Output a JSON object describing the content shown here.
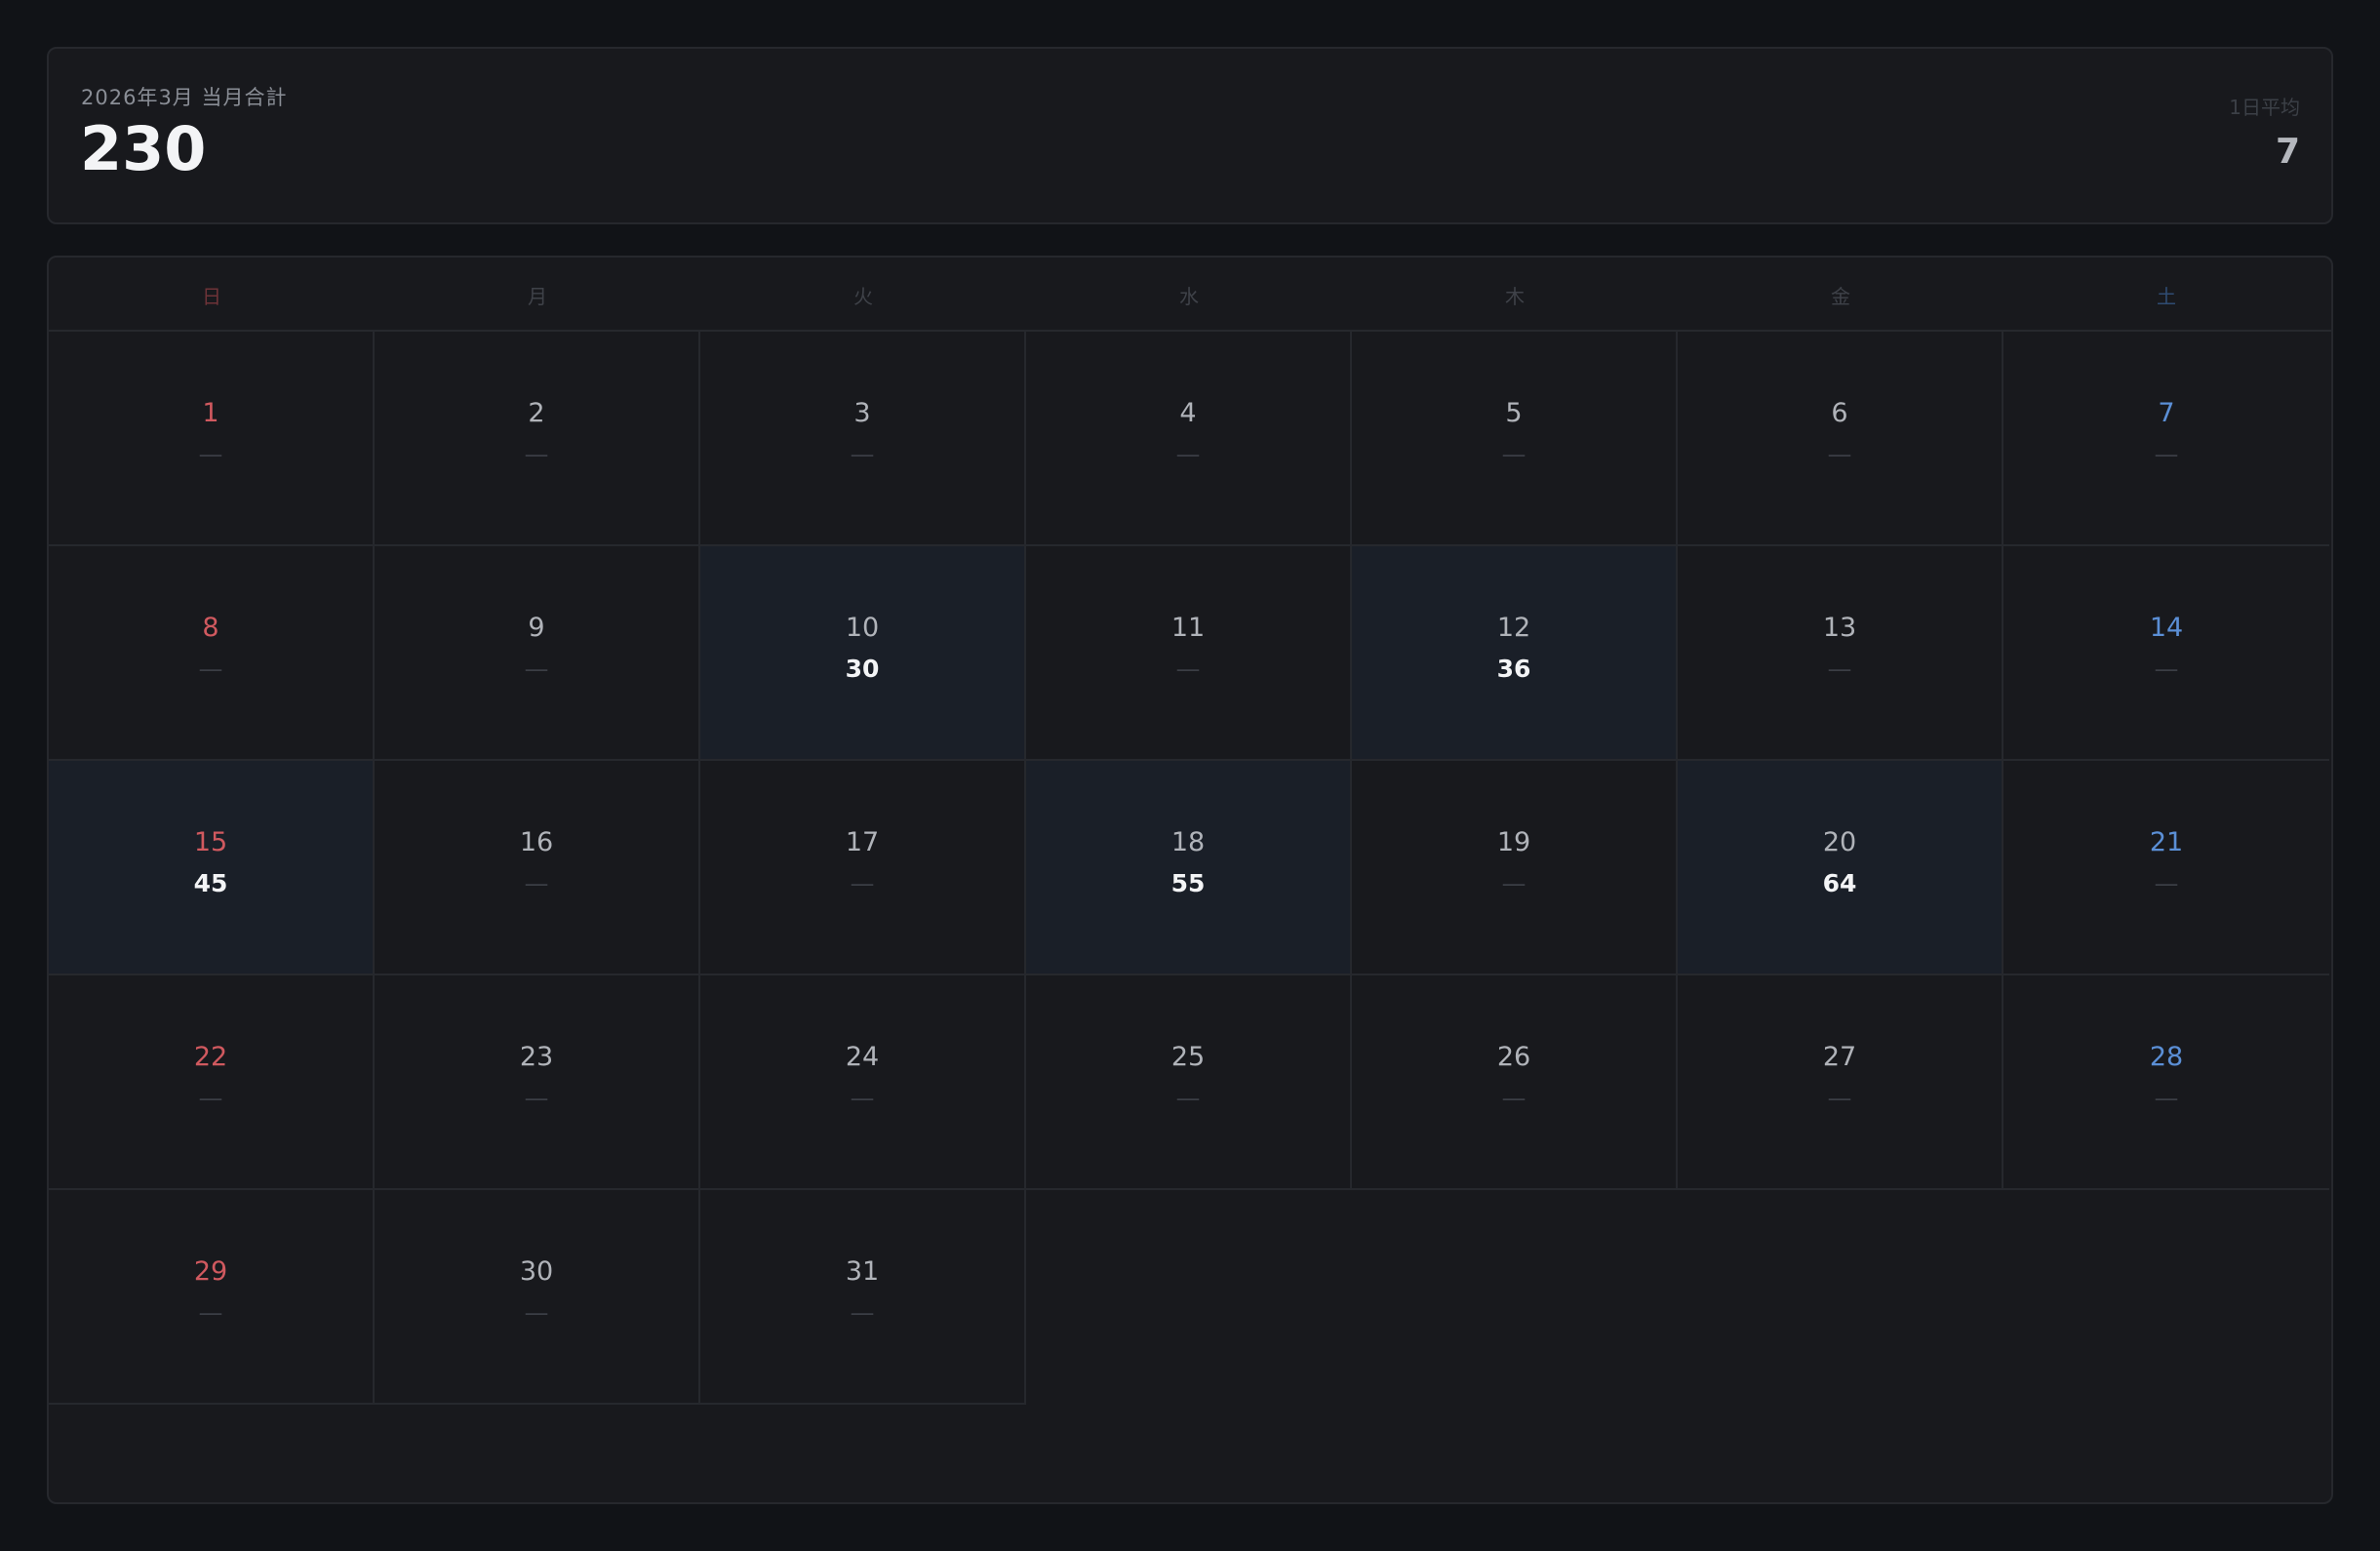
{
  "summary": {
    "title": "2026年3月 当月合計",
    "total": "230",
    "avg_label": "1日平均",
    "avg_value": "7"
  },
  "calendar": {
    "weekdays": [
      "日",
      "月",
      "火",
      "水",
      "木",
      "金",
      "土"
    ],
    "empty_marker": "—",
    "first_weekday_index": 0,
    "days": [
      {
        "day": "1",
        "value": null
      },
      {
        "day": "2",
        "value": null
      },
      {
        "day": "3",
        "value": null
      },
      {
        "day": "4",
        "value": null
      },
      {
        "day": "5",
        "value": null
      },
      {
        "day": "6",
        "value": null
      },
      {
        "day": "7",
        "value": null
      },
      {
        "day": "8",
        "value": null
      },
      {
        "day": "9",
        "value": null
      },
      {
        "day": "10",
        "value": "30"
      },
      {
        "day": "11",
        "value": null
      },
      {
        "day": "12",
        "value": "36"
      },
      {
        "day": "13",
        "value": null
      },
      {
        "day": "14",
        "value": null
      },
      {
        "day": "15",
        "value": "45"
      },
      {
        "day": "16",
        "value": null
      },
      {
        "day": "17",
        "value": null
      },
      {
        "day": "18",
        "value": "55"
      },
      {
        "day": "19",
        "value": null
      },
      {
        "day": "20",
        "value": "64"
      },
      {
        "day": "21",
        "value": null
      },
      {
        "day": "22",
        "value": null
      },
      {
        "day": "23",
        "value": null
      },
      {
        "day": "24",
        "value": null
      },
      {
        "day": "25",
        "value": null
      },
      {
        "day": "26",
        "value": null
      },
      {
        "day": "27",
        "value": null
      },
      {
        "day": "28",
        "value": null
      },
      {
        "day": "29",
        "value": null
      },
      {
        "day": "30",
        "value": null
      },
      {
        "day": "31",
        "value": null
      }
    ]
  },
  "colors": {
    "background": "#111317",
    "card": "#18191d",
    "highlight_cell": "#1a1f28",
    "sunday": "#d0595f",
    "saturday": "#5b8fd6"
  }
}
